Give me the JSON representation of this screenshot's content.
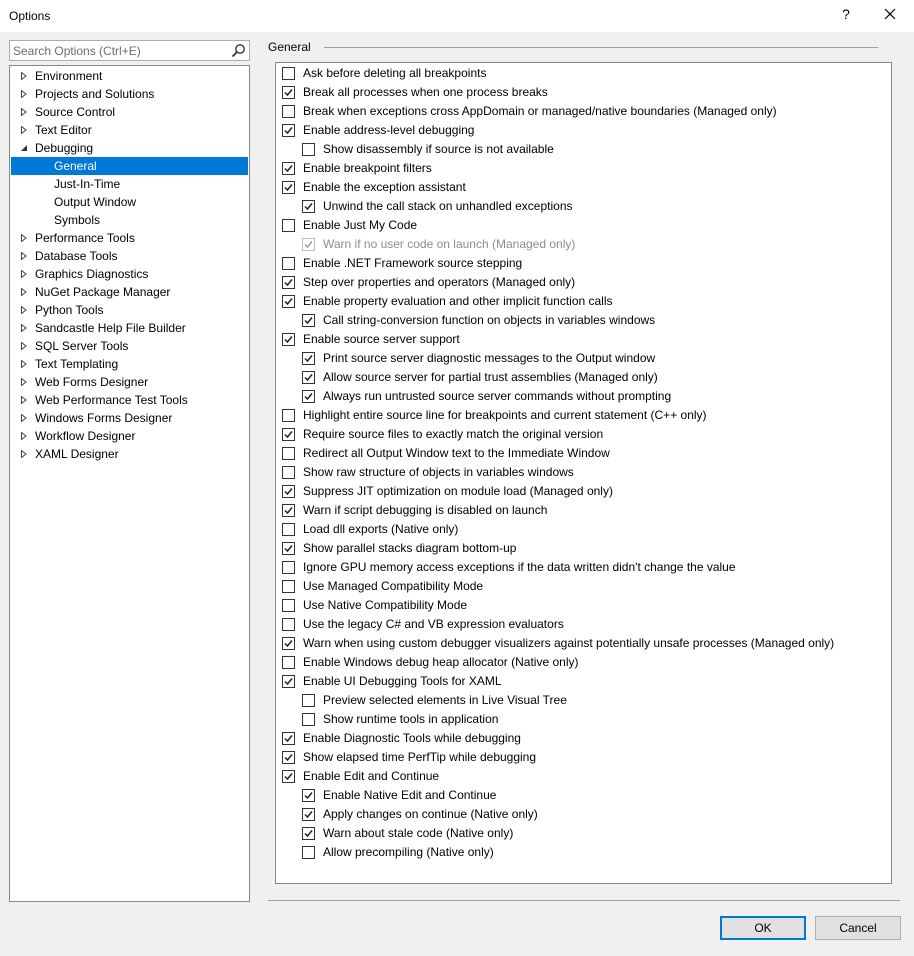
{
  "window": {
    "title": "Options",
    "help_label": "?"
  },
  "search": {
    "placeholder": "Search Options (Ctrl+E)"
  },
  "tree": [
    {
      "label": "Environment",
      "level": 0,
      "arrow": "collapsed"
    },
    {
      "label": "Projects and Solutions",
      "level": 0,
      "arrow": "collapsed"
    },
    {
      "label": "Source Control",
      "level": 0,
      "arrow": "collapsed"
    },
    {
      "label": "Text Editor",
      "level": 0,
      "arrow": "collapsed"
    },
    {
      "label": "Debugging",
      "level": 0,
      "arrow": "expanded"
    },
    {
      "label": "General",
      "level": 1,
      "arrow": "none",
      "selected": true
    },
    {
      "label": "Just-In-Time",
      "level": 1,
      "arrow": "none"
    },
    {
      "label": "Output Window",
      "level": 1,
      "arrow": "none"
    },
    {
      "label": "Symbols",
      "level": 1,
      "arrow": "none"
    },
    {
      "label": "Performance Tools",
      "level": 0,
      "arrow": "collapsed"
    },
    {
      "label": "Database Tools",
      "level": 0,
      "arrow": "collapsed"
    },
    {
      "label": "Graphics Diagnostics",
      "level": 0,
      "arrow": "collapsed"
    },
    {
      "label": "NuGet Package Manager",
      "level": 0,
      "arrow": "collapsed"
    },
    {
      "label": "Python Tools",
      "level": 0,
      "arrow": "collapsed"
    },
    {
      "label": "Sandcastle Help File Builder",
      "level": 0,
      "arrow": "collapsed"
    },
    {
      "label": "SQL Server Tools",
      "level": 0,
      "arrow": "collapsed"
    },
    {
      "label": "Text Templating",
      "level": 0,
      "arrow": "collapsed"
    },
    {
      "label": "Web Forms Designer",
      "level": 0,
      "arrow": "collapsed"
    },
    {
      "label": "Web Performance Test Tools",
      "level": 0,
      "arrow": "collapsed"
    },
    {
      "label": "Windows Forms Designer",
      "level": 0,
      "arrow": "collapsed"
    },
    {
      "label": "Workflow Designer",
      "level": 0,
      "arrow": "collapsed"
    },
    {
      "label": "XAML Designer",
      "level": 0,
      "arrow": "collapsed"
    }
  ],
  "section": {
    "title": "General"
  },
  "options": [
    {
      "label": "Ask before deleting all breakpoints",
      "checked": false,
      "indent": 0
    },
    {
      "label": "Break all processes when one process breaks",
      "checked": true,
      "indent": 0
    },
    {
      "label": "Break when exceptions cross AppDomain or managed/native boundaries (Managed only)",
      "checked": false,
      "indent": 0
    },
    {
      "label": "Enable address-level debugging",
      "checked": true,
      "indent": 0
    },
    {
      "label": "Show disassembly if source is not available",
      "checked": false,
      "indent": 1
    },
    {
      "label": "Enable breakpoint filters",
      "checked": true,
      "indent": 0
    },
    {
      "label": "Enable the exception assistant",
      "checked": true,
      "indent": 0
    },
    {
      "label": "Unwind the call stack on unhandled exceptions",
      "checked": true,
      "indent": 1
    },
    {
      "label": "Enable Just My Code",
      "checked": false,
      "indent": 0
    },
    {
      "label": "Warn if no user code on launch (Managed only)",
      "checked": true,
      "indent": 1,
      "disabled": true
    },
    {
      "label": "Enable .NET Framework source stepping",
      "checked": false,
      "indent": 0
    },
    {
      "label": "Step over properties and operators (Managed only)",
      "checked": true,
      "indent": 0
    },
    {
      "label": "Enable property evaluation and other implicit function calls",
      "checked": true,
      "indent": 0
    },
    {
      "label": "Call string-conversion function on objects in variables windows",
      "checked": true,
      "indent": 1
    },
    {
      "label": "Enable source server support",
      "checked": true,
      "indent": 0
    },
    {
      "label": "Print source server diagnostic messages to the Output window",
      "checked": true,
      "indent": 1
    },
    {
      "label": "Allow source server for partial trust assemblies (Managed only)",
      "checked": true,
      "indent": 1
    },
    {
      "label": "Always run untrusted source server commands without prompting",
      "checked": true,
      "indent": 1
    },
    {
      "label": "Highlight entire source line for breakpoints and current statement (C++ only)",
      "checked": false,
      "indent": 0
    },
    {
      "label": "Require source files to exactly match the original version",
      "checked": true,
      "indent": 0
    },
    {
      "label": "Redirect all Output Window text to the Immediate Window",
      "checked": false,
      "indent": 0
    },
    {
      "label": "Show raw structure of objects in variables windows",
      "checked": false,
      "indent": 0
    },
    {
      "label": "Suppress JIT optimization on module load (Managed only)",
      "checked": true,
      "indent": 0
    },
    {
      "label": "Warn if script debugging is disabled on launch",
      "checked": true,
      "indent": 0
    },
    {
      "label": "Load dll exports (Native only)",
      "checked": false,
      "indent": 0
    },
    {
      "label": "Show parallel stacks diagram bottom-up",
      "checked": true,
      "indent": 0
    },
    {
      "label": "Ignore GPU memory access exceptions if the data written didn't change the value",
      "checked": false,
      "indent": 0
    },
    {
      "label": "Use Managed Compatibility Mode",
      "checked": false,
      "indent": 0
    },
    {
      "label": "Use Native Compatibility Mode",
      "checked": false,
      "indent": 0
    },
    {
      "label": "Use the legacy C# and VB expression evaluators",
      "checked": false,
      "indent": 0
    },
    {
      "label": "Warn when using custom debugger visualizers against potentially unsafe processes (Managed only)",
      "checked": true,
      "indent": 0
    },
    {
      "label": "Enable Windows debug heap allocator (Native only)",
      "checked": false,
      "indent": 0
    },
    {
      "label": "Enable UI Debugging Tools for XAML",
      "checked": true,
      "indent": 0
    },
    {
      "label": "Preview selected elements in Live Visual Tree",
      "checked": false,
      "indent": 1
    },
    {
      "label": "Show runtime tools in application",
      "checked": false,
      "indent": 1
    },
    {
      "label": "Enable Diagnostic Tools while debugging",
      "checked": true,
      "indent": 0
    },
    {
      "label": "Show elapsed time PerfTip while debugging",
      "checked": true,
      "indent": 0
    },
    {
      "label": "Enable Edit and Continue",
      "checked": true,
      "indent": 0
    },
    {
      "label": "Enable Native Edit and Continue",
      "checked": true,
      "indent": 1
    },
    {
      "label": "Apply changes on continue (Native only)",
      "checked": true,
      "indent": 1
    },
    {
      "label": "Warn about stale code (Native only)",
      "checked": true,
      "indent": 1
    },
    {
      "label": "Allow precompiling (Native only)",
      "checked": false,
      "indent": 1
    }
  ],
  "buttons": {
    "ok": "OK",
    "cancel": "Cancel"
  },
  "colors": {
    "accent": "#0078d7",
    "selected_text": "#ffffff"
  }
}
